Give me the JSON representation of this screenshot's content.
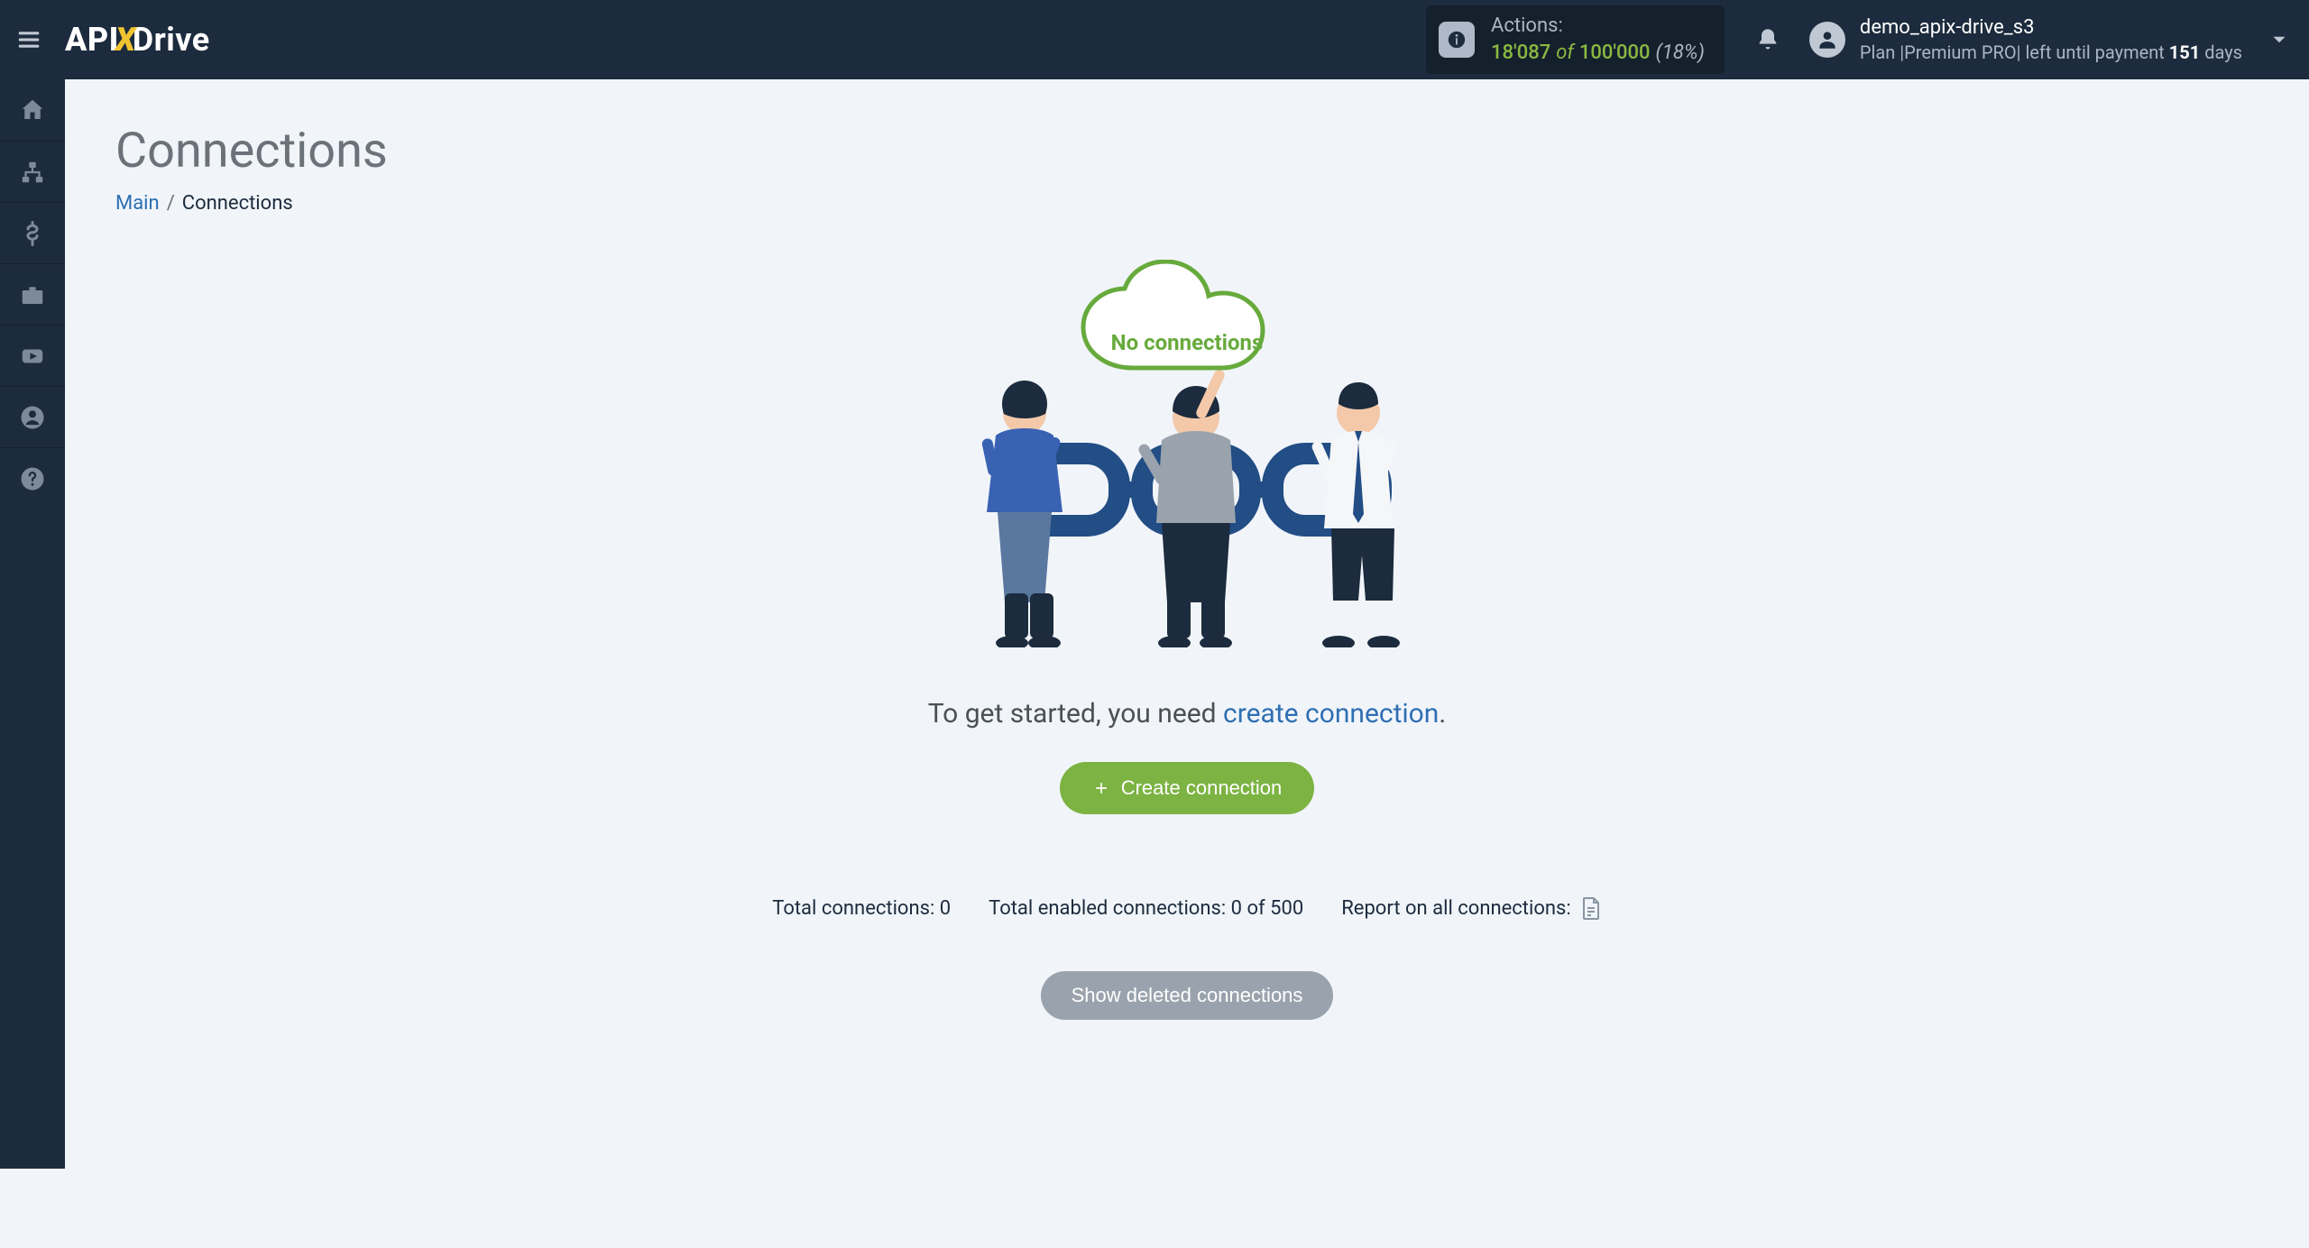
{
  "header": {
    "logo": {
      "api": "API",
      "x": "X",
      "drive": "Drive"
    },
    "actions_pill": {
      "label": "Actions:",
      "used": "18'087",
      "of": "of",
      "total": "100'000",
      "pct": "(18%)"
    },
    "user": {
      "name": "demo_apix-drive_s3",
      "plan_text": "Plan |Premium PRO| left until payment ",
      "days_num": "151",
      "days_suffix": " days"
    }
  },
  "sidebar": {
    "items": [
      "home",
      "sitemap",
      "dollar",
      "briefcase",
      "youtube",
      "user",
      "help"
    ]
  },
  "page": {
    "title": "Connections",
    "breadcrumb": {
      "main": "Main",
      "current": "Connections"
    },
    "cloud_label": "No connections",
    "get_started_prefix": "To get started, you need ",
    "get_started_link": "create connection",
    "get_started_suffix": ".",
    "create_btn": "Create connection",
    "stats": {
      "total": "Total connections: 0",
      "enabled": "Total enabled connections: 0 of 500",
      "report": "Report on all connections:"
    },
    "deleted_btn": "Show deleted connections"
  }
}
